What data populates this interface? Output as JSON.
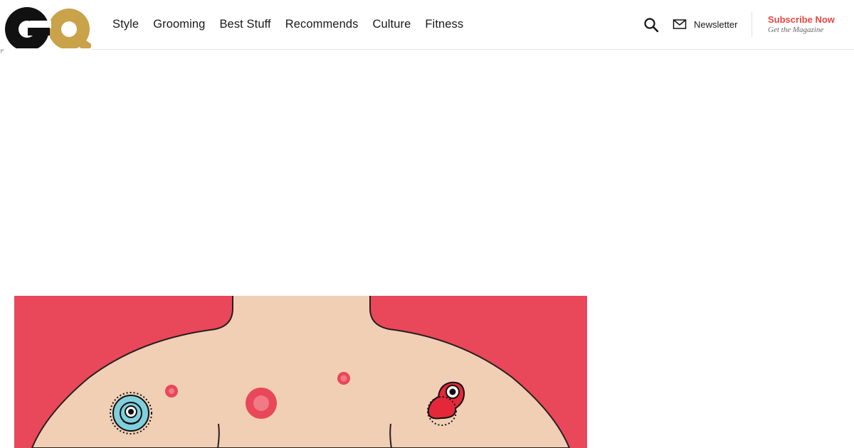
{
  "brand": {
    "logo_text": "GQ",
    "colors": {
      "dark": "#111111",
      "gold": "#c9a24a"
    }
  },
  "nav": {
    "items": [
      {
        "label": "Style"
      },
      {
        "label": "Grooming"
      },
      {
        "label": "Best Stuff"
      },
      {
        "label": "Recommends"
      },
      {
        "label": "Culture"
      },
      {
        "label": "Fitness"
      }
    ]
  },
  "header_actions": {
    "search_icon": "search-icon",
    "newsletter_icon": "mail-icon",
    "newsletter_label": "Newsletter",
    "subscribe_label": "Subscribe Now",
    "subscribe_sublabel": "Get the Magazine"
  },
  "hero": {
    "description": "Illustration of a shirtless torso with pimples and cartoon germs on a red background",
    "colors": {
      "background": "#e9475a",
      "skin": "#f0cfb5",
      "germ_blue": "#7fd0dc",
      "germ_red": "#e5273a"
    }
  },
  "theme": {
    "accent": "#e8473f"
  }
}
